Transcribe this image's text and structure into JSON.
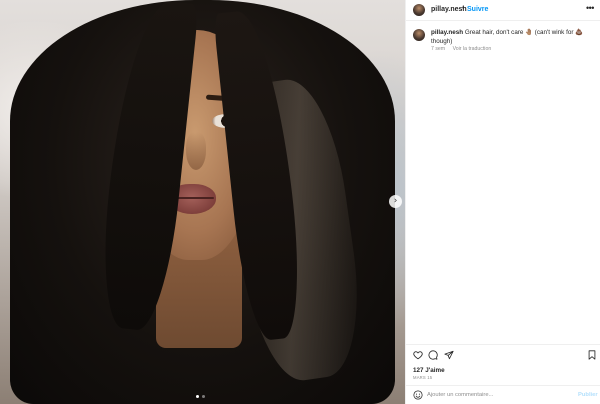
{
  "post": {
    "username": "pillay.nesh",
    "follow_label": "Suivre",
    "header_separator": "•",
    "more_icon": "more-horizontal-icon",
    "caption_prefix": "Great hair, don't care",
    "caption_emoji": "🤚🏽",
    "caption_suffix": "(can't wink for",
    "caption_emoji2": "💩",
    "caption_tail": "though)",
    "time_ago": "7 sem",
    "translation_label": "Voir la traduction",
    "likes": "127 J'aime",
    "date": "MARS 15",
    "comment_placeholder": "Ajouter un commentaire...",
    "publish_label": "Publier"
  },
  "carousel": {
    "next_icon": "chevron-right-icon",
    "dot_count": 2,
    "active_dot": 1
  },
  "icons": {
    "like": "heart-icon",
    "comment": "comment-icon",
    "share": "send-icon",
    "save": "bookmark-icon",
    "emoji": "emoji-icon"
  },
  "colors": {
    "link_blue": "#0095f6",
    "publish_disabled": "#b2dffc",
    "text": "#262626",
    "muted": "#8e8e8e",
    "divider": "#efefef"
  }
}
